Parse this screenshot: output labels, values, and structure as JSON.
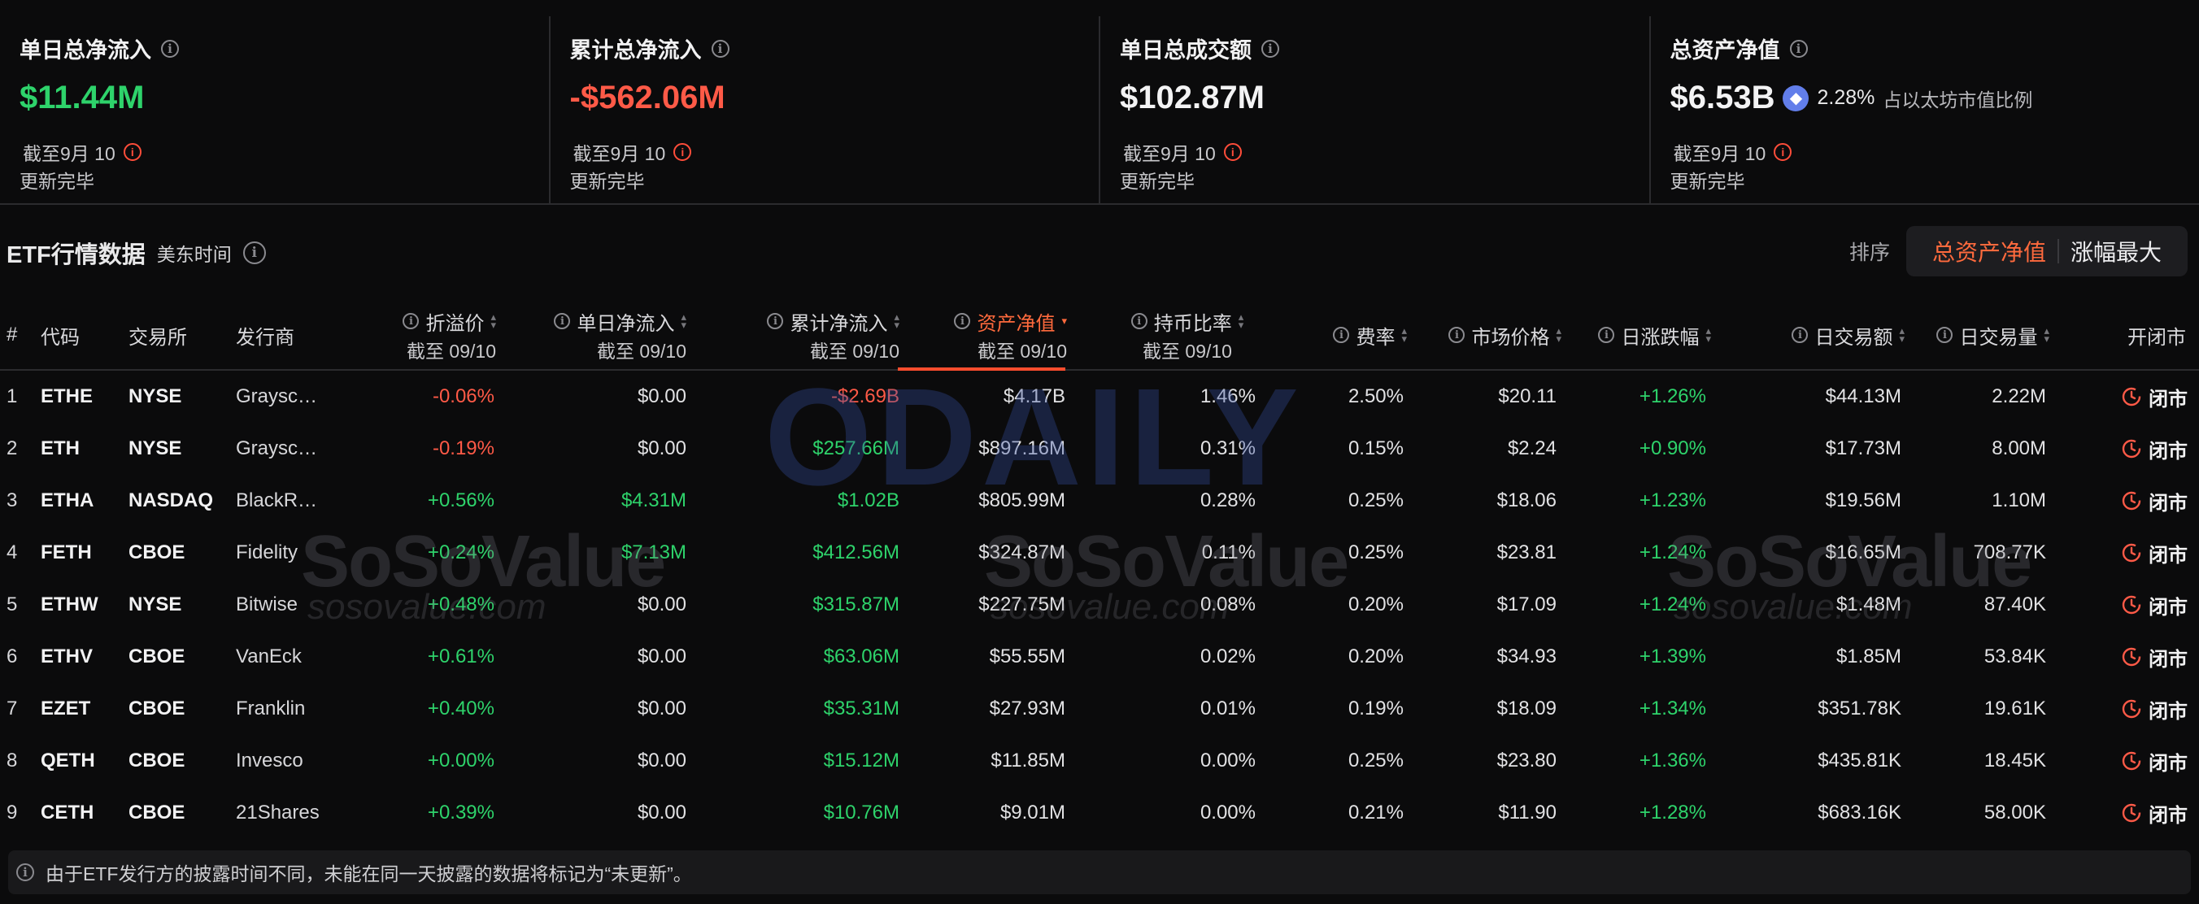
{
  "cards": [
    {
      "title": "单日总净流入",
      "value": "$11.44M",
      "tone": "pos",
      "date": "截至9月 10",
      "status": "更新完毕"
    },
    {
      "title": "累计总净流入",
      "value": "-$562.06M",
      "tone": "neg",
      "date": "截至9月 10",
      "status": "更新完毕"
    },
    {
      "title": "单日总成交额",
      "value": "$102.87M",
      "tone": "white",
      "date": "截至9月 10",
      "status": "更新完毕"
    },
    {
      "title": "总资产净值",
      "value": "$6.53B",
      "tone": "white",
      "pct": "2.28%",
      "pct_label": "占以太坊市值比例",
      "date": "截至9月 10",
      "status": "更新完毕"
    }
  ],
  "section": {
    "title": "ETF行情数据",
    "timezone": "美东时间"
  },
  "sort": {
    "label": "排序",
    "options": [
      "总资产净值",
      "涨幅最大"
    ],
    "active_index": 0
  },
  "columns": {
    "index": "#",
    "code": "代码",
    "exchange": "交易所",
    "issuer": "发行商",
    "premium": "折溢价",
    "premium_sub": "截至 09/10",
    "daily_inflow": "单日净流入",
    "daily_inflow_sub": "截至 09/10",
    "cum_inflow": "累计净流入",
    "cum_inflow_sub": "截至 09/10",
    "nav": "资产净值",
    "nav_sub": "截至 09/10",
    "holding": "持币比率",
    "holding_sub": "截至 09/10",
    "fee": "费率",
    "price": "市场价格",
    "change": "日涨跌幅",
    "volume_amt": "日交易额",
    "volume_qty": "日交易量",
    "market_status": "开闭市"
  },
  "rows": [
    {
      "i": "1",
      "code": "ETHE",
      "ex": "NYSE",
      "issuer": "Graysc…",
      "premium": "-0.06%",
      "premium_tone": "neg",
      "daily": "$0.00",
      "daily_tone": "num",
      "cum": "-$2.69B",
      "cum_tone": "neg",
      "nav": "$4.17B",
      "hold": "1.46%",
      "fee": "2.50%",
      "price": "$20.11",
      "chg": "+1.26%",
      "amt": "$44.13M",
      "qty": "2.22M",
      "status": "闭市"
    },
    {
      "i": "2",
      "code": "ETH",
      "ex": "NYSE",
      "issuer": "Graysc…",
      "premium": "-0.19%",
      "premium_tone": "neg",
      "daily": "$0.00",
      "daily_tone": "num",
      "cum": "$257.66M",
      "cum_tone": "pos",
      "nav": "$897.16M",
      "hold": "0.31%",
      "fee": "0.15%",
      "price": "$2.24",
      "chg": "+0.90%",
      "amt": "$17.73M",
      "qty": "8.00M",
      "status": "闭市"
    },
    {
      "i": "3",
      "code": "ETHA",
      "ex": "NASDAQ",
      "issuer": "BlackR…",
      "premium": "+0.56%",
      "premium_tone": "pos",
      "daily": "$4.31M",
      "daily_tone": "pos",
      "cum": "$1.02B",
      "cum_tone": "pos",
      "nav": "$805.99M",
      "hold": "0.28%",
      "fee": "0.25%",
      "price": "$18.06",
      "chg": "+1.23%",
      "amt": "$19.56M",
      "qty": "1.10M",
      "status": "闭市"
    },
    {
      "i": "4",
      "code": "FETH",
      "ex": "CBOE",
      "issuer": "Fidelity",
      "premium": "+0.24%",
      "premium_tone": "pos",
      "daily": "$7.13M",
      "daily_tone": "pos",
      "cum": "$412.56M",
      "cum_tone": "pos",
      "nav": "$324.87M",
      "hold": "0.11%",
      "fee": "0.25%",
      "price": "$23.81",
      "chg": "+1.24%",
      "amt": "$16.65M",
      "qty": "708.77K",
      "status": "闭市"
    },
    {
      "i": "5",
      "code": "ETHW",
      "ex": "NYSE",
      "issuer": "Bitwise",
      "premium": "+0.48%",
      "premium_tone": "pos",
      "daily": "$0.00",
      "daily_tone": "num",
      "cum": "$315.87M",
      "cum_tone": "pos",
      "nav": "$227.75M",
      "hold": "0.08%",
      "fee": "0.20%",
      "price": "$17.09",
      "chg": "+1.24%",
      "amt": "$1.48M",
      "qty": "87.40K",
      "status": "闭市"
    },
    {
      "i": "6",
      "code": "ETHV",
      "ex": "CBOE",
      "issuer": "VanEck",
      "premium": "+0.61%",
      "premium_tone": "pos",
      "daily": "$0.00",
      "daily_tone": "num",
      "cum": "$63.06M",
      "cum_tone": "pos",
      "nav": "$55.55M",
      "hold": "0.02%",
      "fee": "0.20%",
      "price": "$34.93",
      "chg": "+1.39%",
      "amt": "$1.85M",
      "qty": "53.84K",
      "status": "闭市"
    },
    {
      "i": "7",
      "code": "EZET",
      "ex": "CBOE",
      "issuer": "Franklin",
      "premium": "+0.40%",
      "premium_tone": "pos",
      "daily": "$0.00",
      "daily_tone": "num",
      "cum": "$35.31M",
      "cum_tone": "pos",
      "nav": "$27.93M",
      "hold": "0.01%",
      "fee": "0.19%",
      "price": "$18.09",
      "chg": "+1.34%",
      "amt": "$351.78K",
      "qty": "19.61K",
      "status": "闭市"
    },
    {
      "i": "8",
      "code": "QETH",
      "ex": "CBOE",
      "issuer": "Invesco",
      "premium": "+0.00%",
      "premium_tone": "pos",
      "daily": "$0.00",
      "daily_tone": "num",
      "cum": "$15.12M",
      "cum_tone": "pos",
      "nav": "$11.85M",
      "hold": "0.00%",
      "fee": "0.25%",
      "price": "$23.80",
      "chg": "+1.36%",
      "amt": "$435.81K",
      "qty": "18.45K",
      "status": "闭市"
    },
    {
      "i": "9",
      "code": "CETH",
      "ex": "CBOE",
      "issuer": "21Shares",
      "premium": "+0.39%",
      "premium_tone": "pos",
      "daily": "$0.00",
      "daily_tone": "num",
      "cum": "$10.76M",
      "cum_tone": "pos",
      "nav": "$9.01M",
      "hold": "0.00%",
      "fee": "0.21%",
      "price": "$11.90",
      "chg": "+1.28%",
      "amt": "$683.16K",
      "qty": "58.00K",
      "status": "闭市"
    }
  ],
  "watermarks": {
    "brand": "SoSoValue",
    "site": "sosovalue.com",
    "odaily": "ODAILY"
  },
  "note": "由于ETF发行方的披露时间不同，未能在同一天披露的数据将标记为“未更新”。",
  "colors": {
    "positive": "#2ed36b",
    "negative": "#ff5a47",
    "accent": "#ff6a3d",
    "background": "#0b0b0c"
  }
}
